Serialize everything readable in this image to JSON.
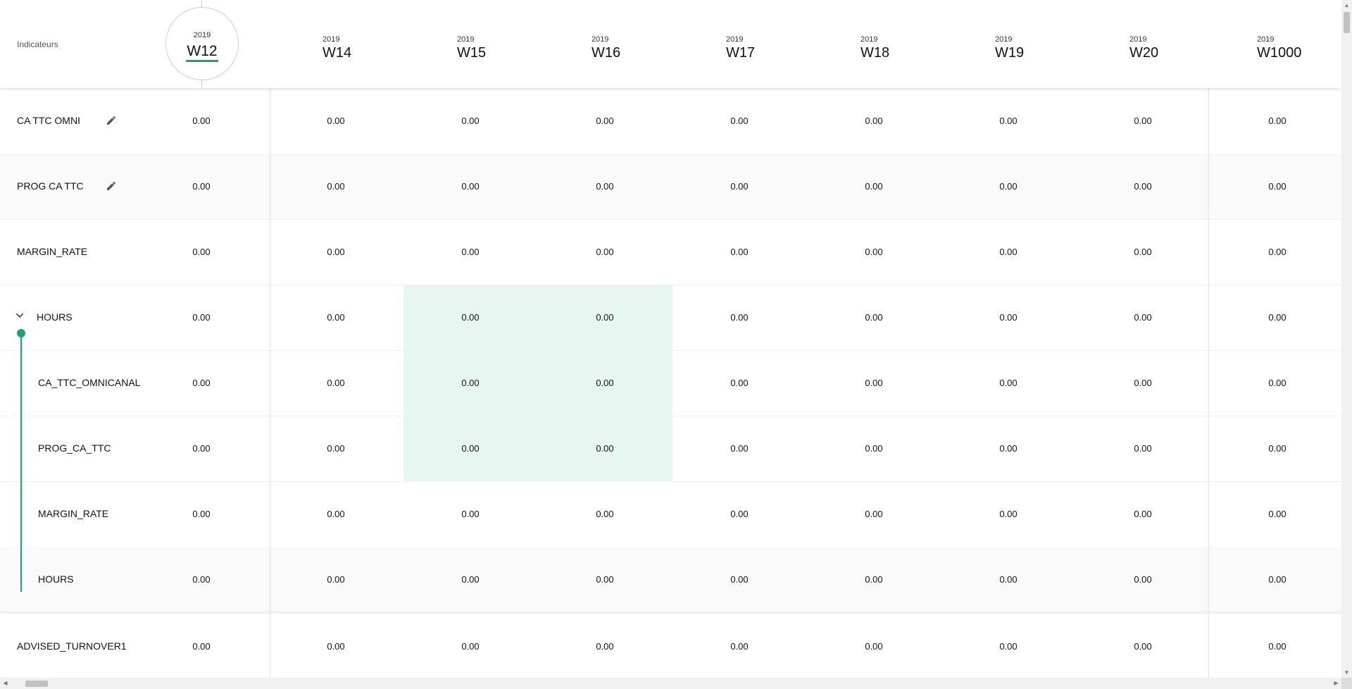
{
  "header": {
    "indicators_label": "Indicateurs",
    "current_week": {
      "year": "2019",
      "week": "W12"
    },
    "weeks": [
      {
        "year": "2019",
        "week": "W14"
      },
      {
        "year": "2019",
        "week": "W15"
      },
      {
        "year": "2019",
        "week": "W16"
      },
      {
        "year": "2019",
        "week": "W17"
      },
      {
        "year": "2019",
        "week": "W18"
      },
      {
        "year": "2019",
        "week": "W19"
      },
      {
        "year": "2019",
        "week": "W20"
      },
      {
        "year": "2019",
        "week": "W1000"
      }
    ]
  },
  "rows": [
    {
      "label": "CA TTC OMNI",
      "editable": true,
      "current": "0.00",
      "values": [
        "0.00",
        "0.00",
        "0.00",
        "0.00",
        "0.00",
        "0.00",
        "0.00",
        "0.00"
      ]
    },
    {
      "label": "PROG CA TTC",
      "editable": true,
      "current": "0.00",
      "values": [
        "0.00",
        "0.00",
        "0.00",
        "0.00",
        "0.00",
        "0.00",
        "0.00",
        "0.00"
      ]
    },
    {
      "label": "MARGIN_RATE",
      "editable": false,
      "current": "0.00",
      "values": [
        "0.00",
        "0.00",
        "0.00",
        "0.00",
        "0.00",
        "0.00",
        "0.00",
        "0.00"
      ]
    },
    {
      "label": "HOURS",
      "expanded": true,
      "current": "0.00",
      "values": [
        "0.00",
        "0.00",
        "0.00",
        "0.00",
        "0.00",
        "0.00",
        "0.00",
        "0.00"
      ]
    },
    {
      "label": "CA_TTC_OMNICANAL",
      "child": true,
      "current": "0.00",
      "values": [
        "0.00",
        "0.00",
        "0.00",
        "0.00",
        "0.00",
        "0.00",
        "0.00",
        "0.00"
      ]
    },
    {
      "label": "PROG_CA_TTC",
      "child": true,
      "current": "0.00",
      "values": [
        "0.00",
        "0.00",
        "0.00",
        "0.00",
        "0.00",
        "0.00",
        "0.00",
        "0.00"
      ]
    },
    {
      "label": "MARGIN_RATE",
      "child": true,
      "current": "0.00",
      "values": [
        "0.00",
        "0.00",
        "0.00",
        "0.00",
        "0.00",
        "0.00",
        "0.00",
        "0.00"
      ]
    },
    {
      "label": "HOURS",
      "child": true,
      "current": "0.00",
      "values": [
        "0.00",
        "0.00",
        "0.00",
        "0.00",
        "0.00",
        "0.00",
        "0.00",
        "0.00"
      ]
    },
    {
      "label": "ADVISED_TURNOVER1",
      "current": "0.00",
      "values": [
        "0.00",
        "0.00",
        "0.00",
        "0.00",
        "0.00",
        "0.00",
        "0.00",
        "0.00"
      ]
    }
  ],
  "icons": {
    "edit": "pencil-icon",
    "expand": "chevron-down-icon"
  },
  "colors": {
    "accent": "#1aa37a",
    "highlight": "#e6f6f1"
  }
}
